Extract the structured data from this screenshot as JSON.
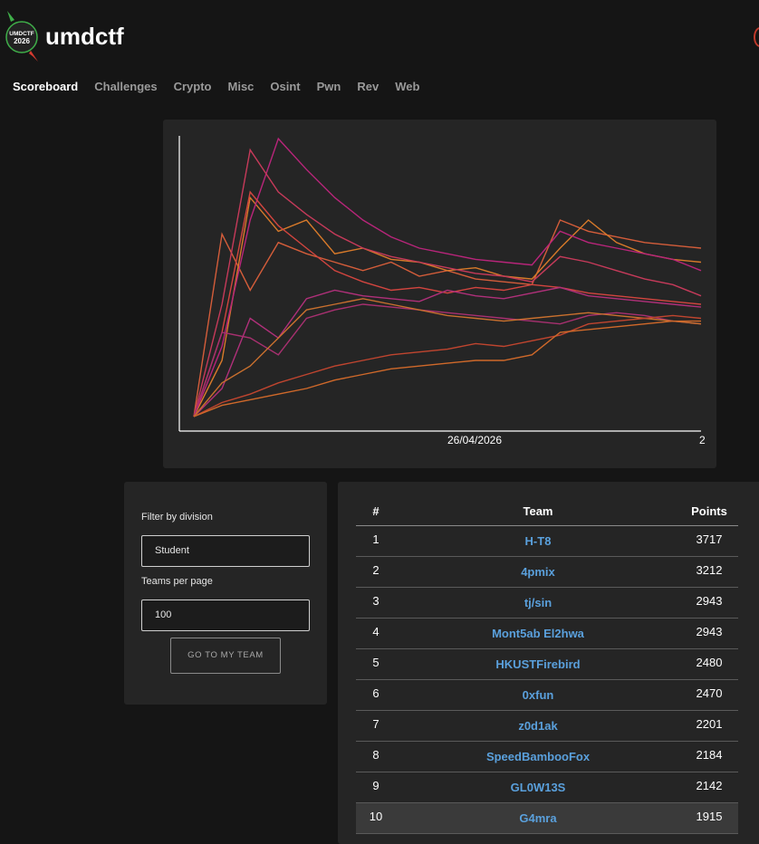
{
  "header": {
    "title": "umdctf",
    "logo": {
      "line1": "UMDCTF",
      "line2": "2026",
      "colors": {
        "badge": "#222222",
        "leaf": "#3fae49",
        "chili": "#d63a2f"
      }
    }
  },
  "nav": {
    "items": [
      {
        "label": "Scoreboard",
        "active": true
      },
      {
        "label": "Challenges"
      },
      {
        "label": "Crypto"
      },
      {
        "label": "Misc"
      },
      {
        "label": "Osint"
      },
      {
        "label": "Pwn"
      },
      {
        "label": "Rev"
      },
      {
        "label": "Web"
      }
    ]
  },
  "chart_data": {
    "type": "line",
    "x_tick_labels": [
      "26/04/2026",
      "2"
    ],
    "axes": {
      "y_tick_labels": false,
      "grid": false
    },
    "series": [
      {
        "color": "#d45d3a",
        "values": [
          0,
          0.65,
          0.45,
          0.62,
          0.58,
          0.55,
          0.52,
          0.55,
          0.5,
          0.52,
          0.49,
          0.48,
          0.47,
          0.7,
          0.66,
          0.64,
          0.62,
          0.61,
          0.6
        ]
      },
      {
        "color": "#d87a2a",
        "values": [
          0,
          0.2,
          0.78,
          0.66,
          0.7,
          0.58,
          0.6,
          0.56,
          0.55,
          0.52,
          0.53,
          0.5,
          0.49,
          0.6,
          0.7,
          0.62,
          0.58,
          0.56,
          0.55
        ]
      },
      {
        "color": "#b8257a",
        "values": [
          0,
          0.25,
          0.7,
          0.99,
          0.88,
          0.78,
          0.7,
          0.64,
          0.6,
          0.58,
          0.56,
          0.55,
          0.54,
          0.66,
          0.62,
          0.6,
          0.58,
          0.56,
          0.52
        ]
      },
      {
        "color": "#c63a5a",
        "values": [
          0,
          0.4,
          0.95,
          0.8,
          0.72,
          0.65,
          0.6,
          0.57,
          0.55,
          0.53,
          0.51,
          0.5,
          0.48,
          0.57,
          0.55,
          0.52,
          0.49,
          0.47,
          0.43
        ]
      },
      {
        "color": "#d2453f",
        "values": [
          0,
          0.3,
          0.8,
          0.68,
          0.6,
          0.52,
          0.48,
          0.45,
          0.46,
          0.44,
          0.46,
          0.45,
          0.47,
          0.46,
          0.44,
          0.43,
          0.42,
          0.41,
          0.4
        ]
      },
      {
        "color": "#b0307a",
        "values": [
          0,
          0.1,
          0.35,
          0.28,
          0.42,
          0.45,
          0.43,
          0.42,
          0.41,
          0.45,
          0.43,
          0.42,
          0.44,
          0.46,
          0.43,
          0.42,
          0.41,
          0.4,
          0.39
        ]
      },
      {
        "color": "#a83070",
        "values": [
          0,
          0.3,
          0.28,
          0.22,
          0.35,
          0.38,
          0.4,
          0.39,
          0.38,
          0.37,
          0.36,
          0.35,
          0.34,
          0.33,
          0.36,
          0.37,
          0.36,
          0.34,
          0.33
        ]
      },
      {
        "color": "#c9702e",
        "values": [
          0,
          0.12,
          0.18,
          0.28,
          0.38,
          0.4,
          0.42,
          0.4,
          0.38,
          0.36,
          0.35,
          0.34,
          0.35,
          0.36,
          0.37,
          0.36,
          0.35,
          0.34,
          0.33
        ]
      },
      {
        "color": "#c0452f",
        "values": [
          0,
          0.05,
          0.08,
          0.12,
          0.15,
          0.18,
          0.2,
          0.22,
          0.23,
          0.24,
          0.26,
          0.25,
          0.27,
          0.29,
          0.33,
          0.34,
          0.35,
          0.36,
          0.35
        ]
      },
      {
        "color": "#d0692a",
        "values": [
          0,
          0.04,
          0.06,
          0.08,
          0.1,
          0.13,
          0.15,
          0.17,
          0.18,
          0.19,
          0.2,
          0.2,
          0.22,
          0.3,
          0.31,
          0.32,
          0.33,
          0.34,
          0.34
        ]
      }
    ]
  },
  "filters": {
    "division_label": "Filter by division",
    "division_value": "Student",
    "per_page_label": "Teams per page",
    "per_page_value": "100",
    "my_team_button": "Go to my team"
  },
  "scoreboard": {
    "columns": {
      "rank": "#",
      "team": "Team",
      "points": "Points"
    },
    "rows": [
      {
        "rank": "1",
        "team": "H-T8",
        "points": "3717"
      },
      {
        "rank": "2",
        "team": "4pmix",
        "points": "3212"
      },
      {
        "rank": "3",
        "team": "tj/sin",
        "points": "2943"
      },
      {
        "rank": "4",
        "team": "Mont5ab El2hwa",
        "points": "2943"
      },
      {
        "rank": "5",
        "team": "HKUSTFirebird",
        "points": "2480"
      },
      {
        "rank": "6",
        "team": "0xfun",
        "points": "2470"
      },
      {
        "rank": "7",
        "team": "z0d1ak",
        "points": "2201"
      },
      {
        "rank": "8",
        "team": "SpeedBambooFox",
        "points": "2184"
      },
      {
        "rank": "9",
        "team": "GL0W13S",
        "points": "2142"
      },
      {
        "rank": "10",
        "team": "G4mra",
        "points": "1915",
        "highlight": true
      }
    ]
  }
}
